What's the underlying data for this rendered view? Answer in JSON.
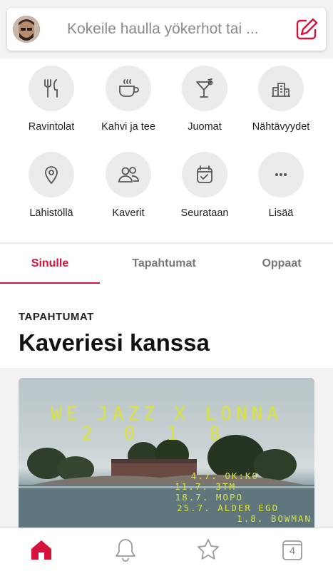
{
  "search": {
    "placeholder": "Kokeile haulla yökerhot tai ..."
  },
  "categories": [
    {
      "label": "Ravintolat",
      "icon": "fork-knife-icon"
    },
    {
      "label": "Kahvi ja tee",
      "icon": "coffee-cup-icon"
    },
    {
      "label": "Juomat",
      "icon": "cocktail-icon"
    },
    {
      "label": "Nähtävyydet",
      "icon": "buildings-icon"
    },
    {
      "label": "Lähistöllä",
      "icon": "location-pin-icon"
    },
    {
      "label": "Kaverit",
      "icon": "people-icon"
    },
    {
      "label": "Seurataan",
      "icon": "calendar-check-icon"
    },
    {
      "label": "Lisää",
      "icon": "more-dots-icon"
    }
  ],
  "tabs": [
    {
      "label": "Sinulle",
      "active": true
    },
    {
      "label": "Tapahtumat",
      "active": false
    },
    {
      "label": "Oppaat",
      "active": false
    }
  ],
  "section": {
    "eyebrow": "TAPAHTUMAT",
    "title": "Kaveriesi kanssa"
  },
  "event_card": {
    "title": "WE JAZZ X LONNA",
    "year": "2018",
    "lineup": [
      "4.7. OK:KO",
      "11.7. 3TM",
      "18.7. MOPO",
      "25.7. ALDER EGO",
      "1.8. BOWMAN"
    ]
  },
  "bottom_nav": {
    "calendar_day": "4"
  },
  "colors": {
    "accent": "#d4123b",
    "poster_text": "#d9e23b"
  }
}
